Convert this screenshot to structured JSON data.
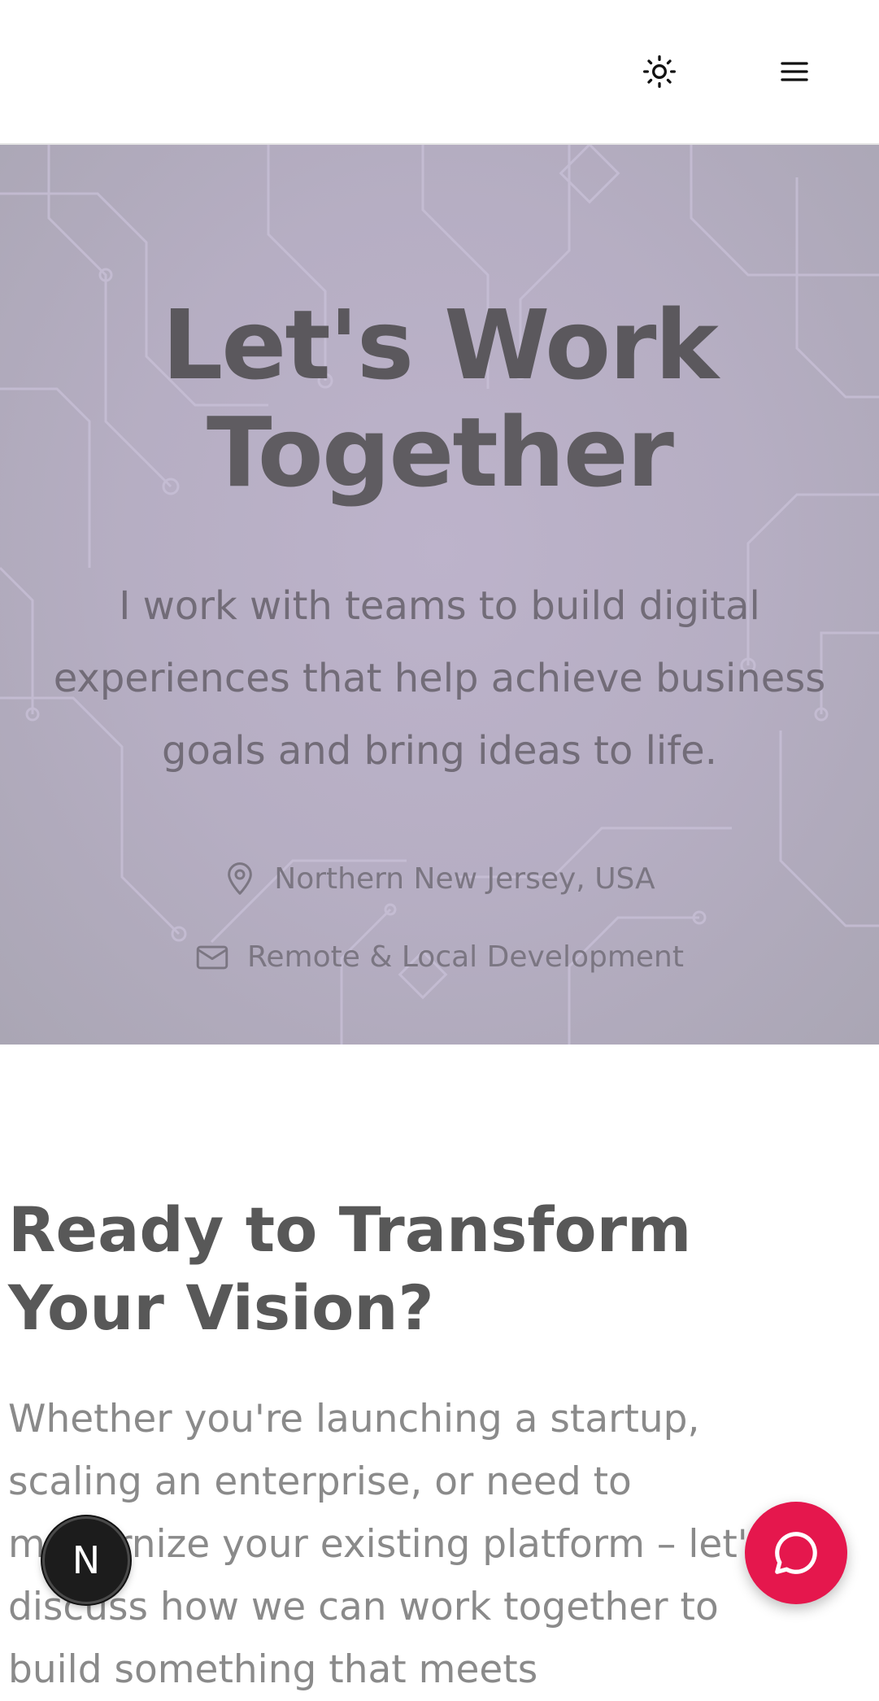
{
  "header": {
    "theme_icon": "sun-icon",
    "menu_icon": "hamburger-menu-icon"
  },
  "hero": {
    "title_line1": "Let's Work",
    "title_line2": "Together",
    "subtitle": "I work with teams to build digital experiences that help achieve business goals and bring ideas to life.",
    "location_icon": "map-pin-icon",
    "location": "Northern New Jersey, USA",
    "mail_icon": "mail-icon",
    "availability": "Remote & Local Development"
  },
  "section": {
    "title": "Ready to Transform Your Vision?",
    "body": "Whether you're launching a startup, scaling an enterprise, or need to modernize your existing platform – let's discuss how we can work together to build something that meets"
  },
  "floating": {
    "badge_letter": "N",
    "chat_icon": "chat-bubble-icon"
  },
  "colors": {
    "chat_button": "#e5174d",
    "hero_background": "#b6aec3"
  }
}
